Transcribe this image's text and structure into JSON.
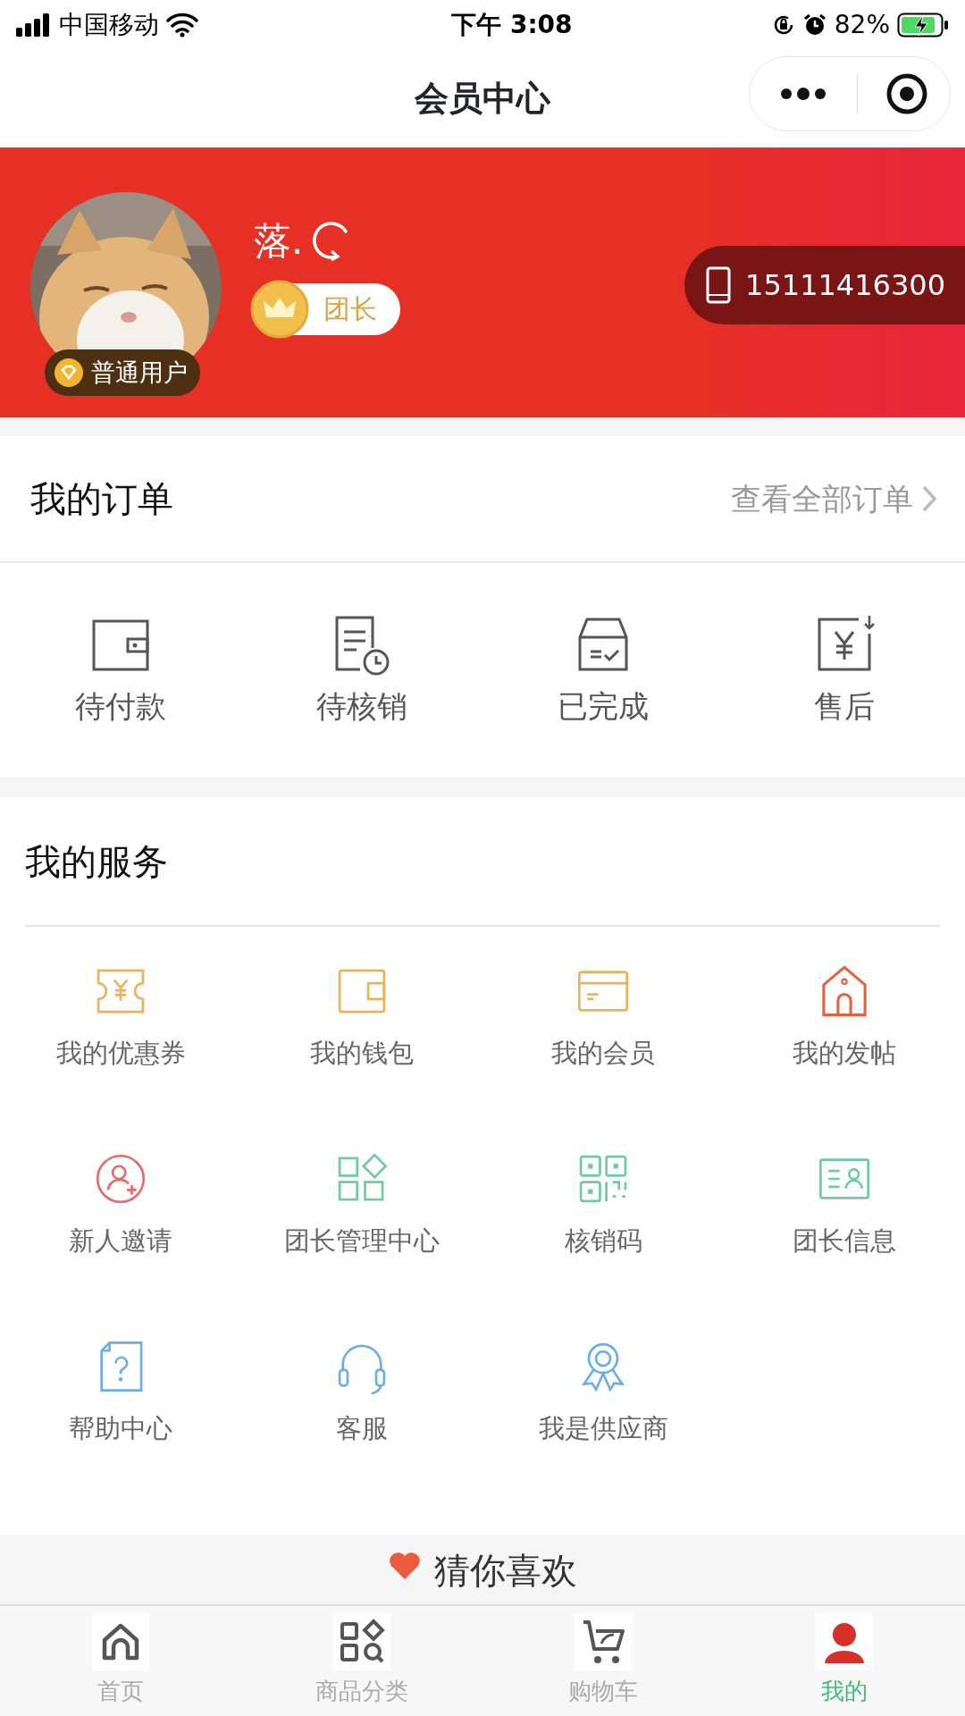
{
  "status_bar": {
    "carrier": "中国移动",
    "time": "下午 3:08",
    "battery": "82%"
  },
  "nav": {
    "title": "会员中心"
  },
  "profile": {
    "level": "普通用户",
    "name": "落.",
    "role": "团长",
    "phone": "15111416300"
  },
  "orders": {
    "title": "我的订单",
    "link": "查看全部订单",
    "items": [
      {
        "label": "待付款"
      },
      {
        "label": "待核销"
      },
      {
        "label": "已完成"
      },
      {
        "label": "售后"
      }
    ]
  },
  "services": {
    "title": "我的服务",
    "items": [
      {
        "label": "我的优惠券",
        "color": "#e9b35a"
      },
      {
        "label": "我的钱包",
        "color": "#e9b35a"
      },
      {
        "label": "我的会员",
        "color": "#e9b35a"
      },
      {
        "label": "我的发帖",
        "color": "#e2643f"
      },
      {
        "label": "新人邀请",
        "color": "#e76a6a"
      },
      {
        "label": "团长管理中心",
        "color": "#6ccca0"
      },
      {
        "label": "核销码",
        "color": "#6ccca0"
      },
      {
        "label": "团长信息",
        "color": "#6ccca0"
      },
      {
        "label": "帮助中心",
        "color": "#6aaee8"
      },
      {
        "label": "客服",
        "color": "#6aaee8"
      },
      {
        "label": "我是供应商",
        "color": "#6aaee8"
      }
    ]
  },
  "recommend": {
    "title": "猜你喜欢"
  },
  "tabbar": [
    {
      "label": "首页",
      "selected": false
    },
    {
      "label": "商品分类",
      "selected": false
    },
    {
      "label": "购物车",
      "selected": false
    },
    {
      "label": "我的",
      "selected": true
    }
  ]
}
